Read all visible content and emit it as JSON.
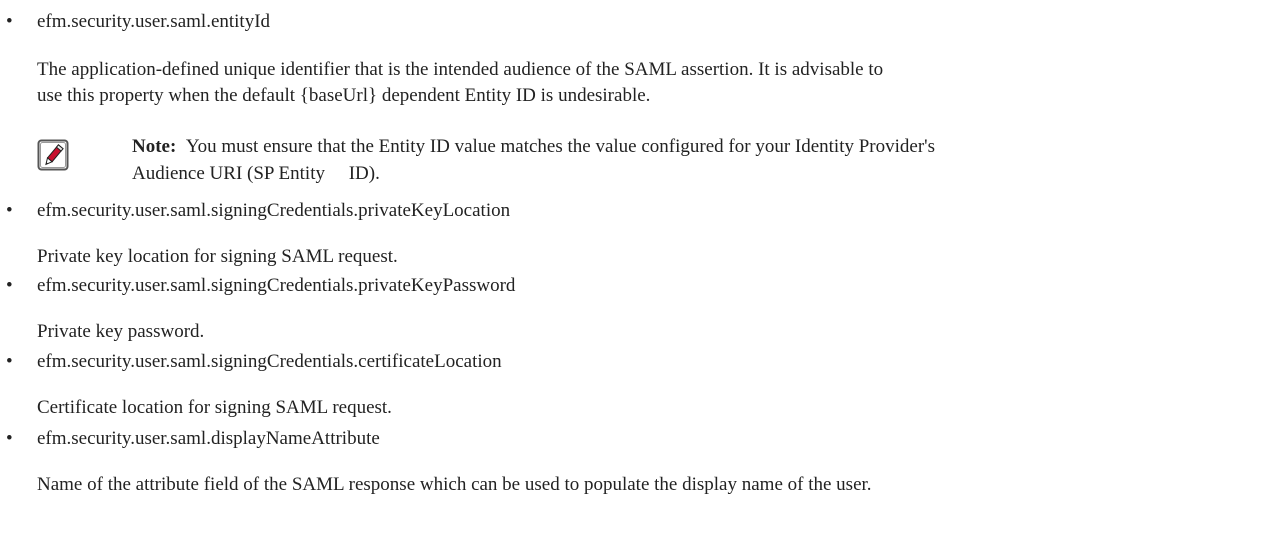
{
  "properties": [
    {
      "name": "efm.security.user.saml.entityId",
      "description_lines": [
        "The application-defined unique identifier that is the intended audience of the SAML assertion. It is advisable to",
        "use this property when the default {baseUrl} dependent Entity ID is undesirable."
      ],
      "note": {
        "icon": "note-pencil-icon",
        "label": "Note:",
        "line1": "You must ensure that the Entity ID value matches the value configured for your Identity Provider's",
        "line2": "Audience URI (SP Entity     ID)."
      }
    },
    {
      "name": "efm.security.user.saml.signingCredentials.privateKeyLocation",
      "description": "Private key location for signing SAML request."
    },
    {
      "name": "efm.security.user.saml.signingCredentials.privateKeyPassword",
      "description": "Private key password."
    },
    {
      "name": "efm.security.user.saml.signingCredentials.certificateLocation",
      "description": "Certificate location for signing SAML request."
    },
    {
      "name": "efm.security.user.saml.displayNameAttribute",
      "description": "Name of the attribute field of the SAML response which can be used to populate the display name of the user."
    }
  ],
  "bullet_glyph": "•",
  "colors": {
    "text": "#222222",
    "icon_red": "#c8102e",
    "icon_border": "#555555"
  }
}
